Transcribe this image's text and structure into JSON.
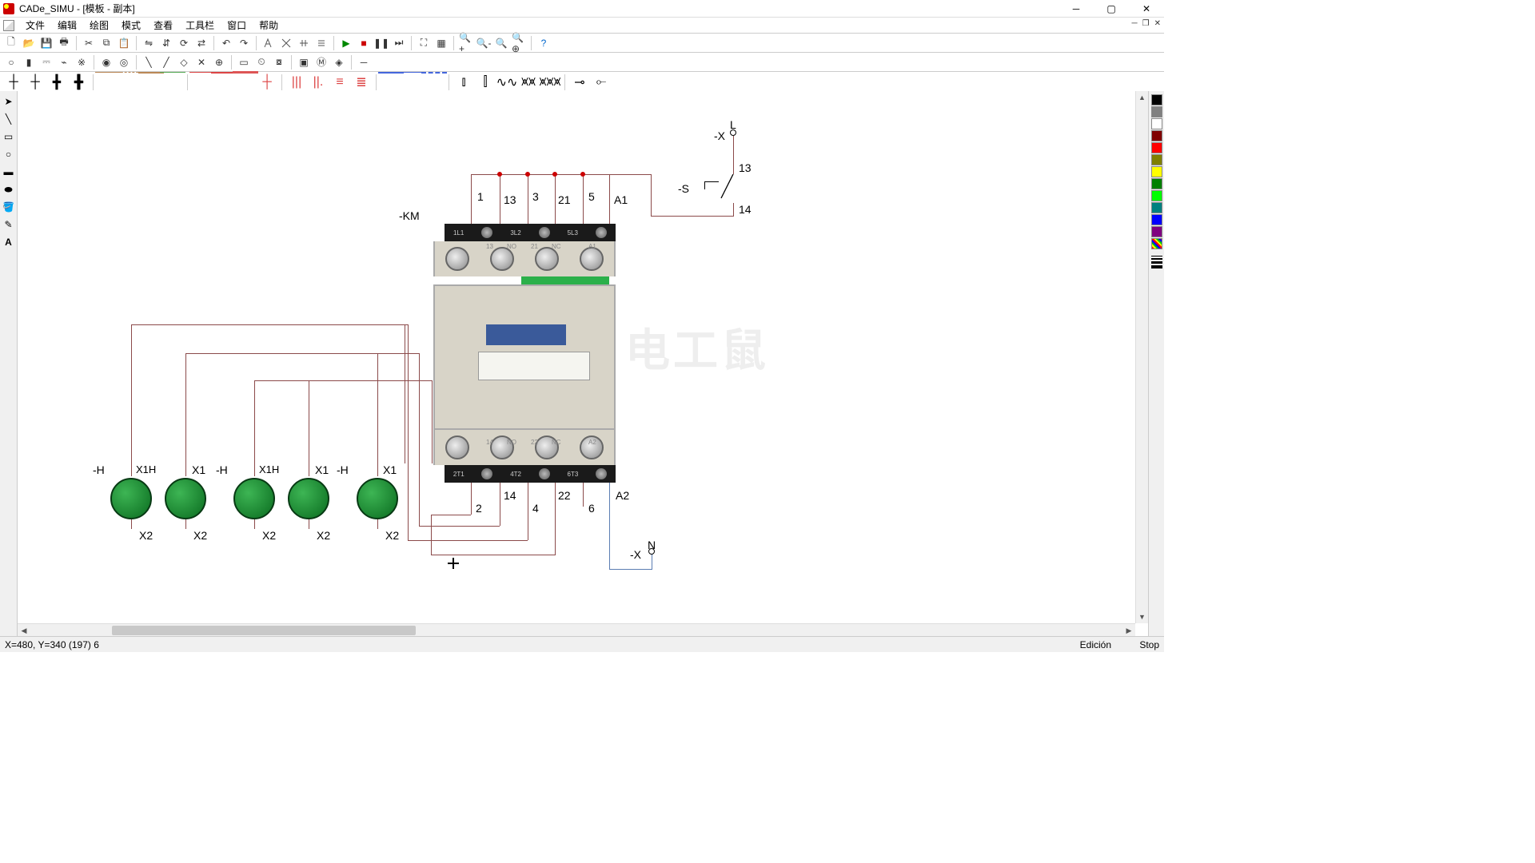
{
  "titlebar": {
    "title": "CADe_SIMU - [模板 - 副本]"
  },
  "menubar": {
    "items": [
      "文件",
      "编辑",
      "绘图",
      "模式",
      "查看",
      "工具栏",
      "窗口",
      "帮助"
    ]
  },
  "statusbar": {
    "coord": "X=480, Y=340 (197) 6",
    "mode": "Edición",
    "run": "Stop"
  },
  "circuit": {
    "km_label": "-KM",
    "top_terminals": [
      "1",
      "13",
      "3",
      "21",
      "5",
      "A1"
    ],
    "bottom_terminals": [
      "2",
      "14",
      "4",
      "22",
      "6",
      "A2"
    ],
    "source_top": {
      "tag": "-X",
      "label": "L",
      "pin": "13"
    },
    "switch": {
      "tag": "-S",
      "pin": "14"
    },
    "source_bot": {
      "tag": "-X",
      "label": "N"
    },
    "lamps": [
      {
        "tag": "-H",
        "top": "X1H",
        "bot": "X2"
      },
      {
        "top": "X1",
        "bot": "X2"
      },
      {
        "tag": "-H",
        "top": "X1H",
        "bot": "X2"
      },
      {
        "top": "X1",
        "bot": "X2"
      },
      {
        "tag": "-H",
        "top": "X1",
        "bot": "X2"
      }
    ]
  },
  "contactor_device": {
    "top_main_labels": [
      "1L1",
      "3L2",
      "5L3"
    ],
    "top_aux_labels": [
      "13",
      "NO",
      "21",
      "NC",
      "A1"
    ],
    "bot_aux_labels": [
      "14",
      "NO",
      "22",
      "NC",
      "A2"
    ],
    "bot_main_labels": [
      "2T1",
      "4T2",
      "6T3"
    ]
  },
  "colors": {
    "palette": [
      "#000000",
      "#808080",
      "#ffffff",
      "#800000",
      "#ff0000",
      "#808000",
      "#ffff00",
      "#008000",
      "#00ff00",
      "#008080",
      "#0000ff",
      "#800080"
    ],
    "hatch": "hatch"
  }
}
